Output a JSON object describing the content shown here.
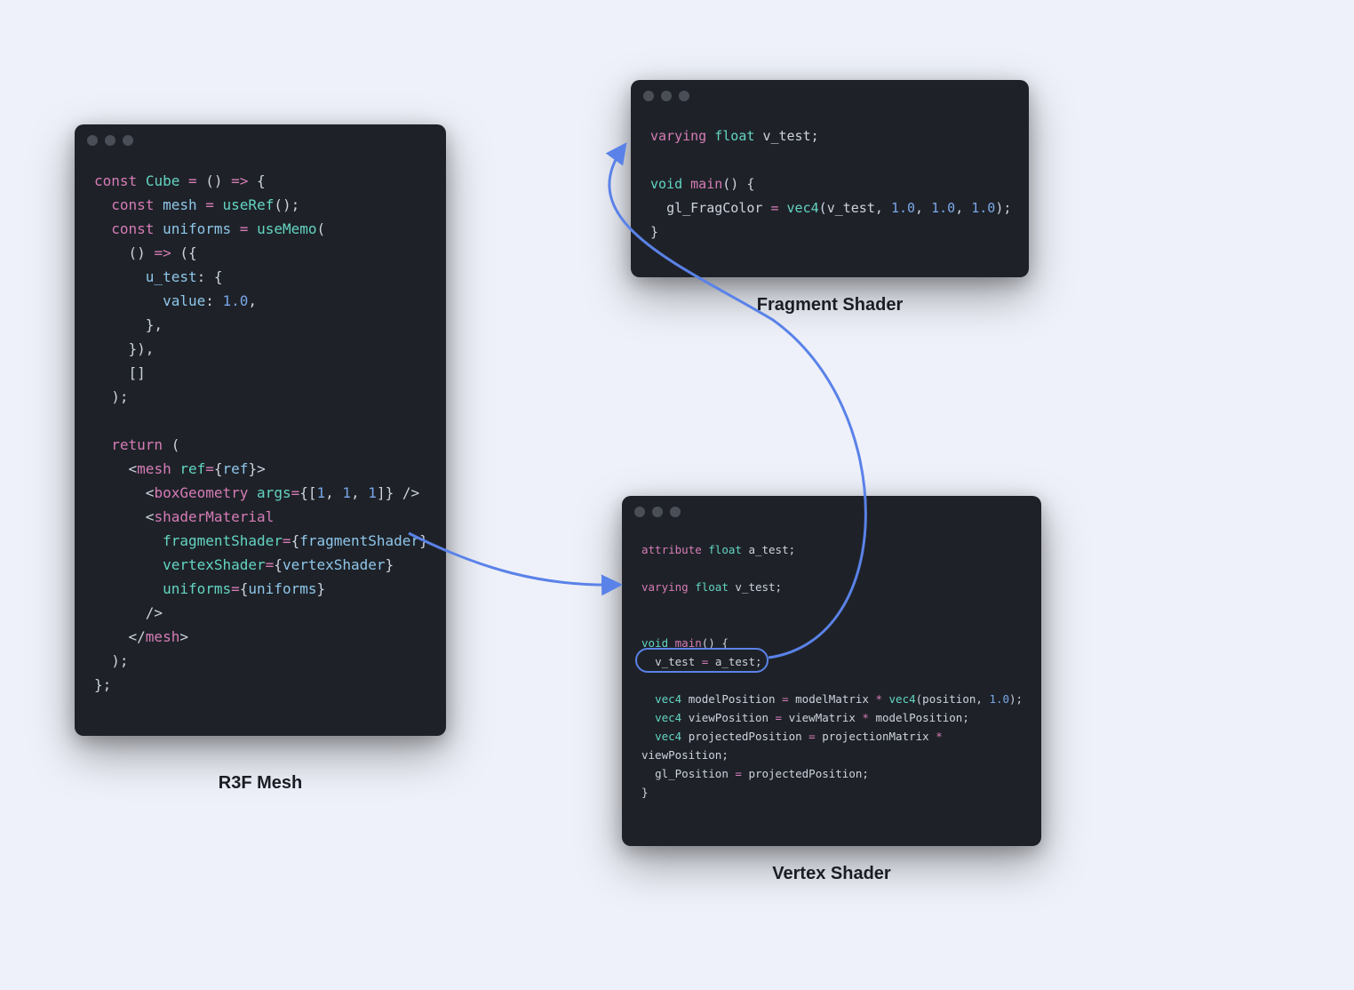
{
  "labels": {
    "r3f": "R3F Mesh",
    "fragment": "Fragment Shader",
    "vertex": "Vertex Shader"
  },
  "windows": {
    "r3f": {
      "fontSize": "16px",
      "lineHeight": "27px",
      "tokens": [
        [
          [
            "tk-kw",
            "const"
          ],
          [
            "tk-punc",
            " "
          ],
          [
            "tk-type",
            "Cube"
          ],
          [
            "tk-punc",
            " "
          ],
          [
            "tk-op",
            "="
          ],
          [
            "tk-punc",
            " () "
          ],
          [
            "tk-op",
            "=>"
          ],
          [
            "tk-punc",
            " {"
          ]
        ],
        [
          [
            "tk-punc",
            "  "
          ],
          [
            "tk-kw",
            "const"
          ],
          [
            "tk-punc",
            " "
          ],
          [
            "tk-prop",
            "mesh"
          ],
          [
            "tk-punc",
            " "
          ],
          [
            "tk-op",
            "="
          ],
          [
            "tk-punc",
            " "
          ],
          [
            "tk-type",
            "useRef"
          ],
          [
            "tk-punc",
            "();"
          ]
        ],
        [
          [
            "tk-punc",
            "  "
          ],
          [
            "tk-kw",
            "const"
          ],
          [
            "tk-punc",
            " "
          ],
          [
            "tk-prop",
            "uniforms"
          ],
          [
            "tk-punc",
            " "
          ],
          [
            "tk-op",
            "="
          ],
          [
            "tk-punc",
            " "
          ],
          [
            "tk-type",
            "useMemo"
          ],
          [
            "tk-punc",
            "("
          ]
        ],
        [
          [
            "tk-punc",
            "    () "
          ],
          [
            "tk-op",
            "=>"
          ],
          [
            "tk-punc",
            " ({"
          ]
        ],
        [
          [
            "tk-punc",
            "      "
          ],
          [
            "tk-prop",
            "u_test"
          ],
          [
            "tk-punc",
            ": {"
          ]
        ],
        [
          [
            "tk-punc",
            "        "
          ],
          [
            "tk-prop",
            "value"
          ],
          [
            "tk-punc",
            ": "
          ],
          [
            "tk-num",
            "1.0"
          ],
          [
            "tk-punc",
            ","
          ]
        ],
        [
          [
            "tk-punc",
            "      },"
          ]
        ],
        [
          [
            "tk-punc",
            "    }),"
          ]
        ],
        [
          [
            "tk-punc",
            "    []"
          ]
        ],
        [
          [
            "tk-punc",
            "  );"
          ]
        ],
        [
          [
            "tk-punc",
            ""
          ]
        ],
        [
          [
            "tk-punc",
            "  "
          ],
          [
            "tk-kw",
            "return"
          ],
          [
            "tk-punc",
            " ("
          ]
        ],
        [
          [
            "tk-punc",
            "    <"
          ],
          [
            "tk-tag",
            "mesh"
          ],
          [
            "tk-punc",
            " "
          ],
          [
            "tk-attr",
            "ref"
          ],
          [
            "tk-op",
            "="
          ],
          [
            "tk-punc",
            "{"
          ],
          [
            "tk-prop",
            "ref"
          ],
          [
            "tk-punc",
            "}>"
          ]
        ],
        [
          [
            "tk-punc",
            "      <"
          ],
          [
            "tk-tag",
            "boxGeometry"
          ],
          [
            "tk-punc",
            " "
          ],
          [
            "tk-attr",
            "args"
          ],
          [
            "tk-op",
            "="
          ],
          [
            "tk-punc",
            "{["
          ],
          [
            "tk-num",
            "1"
          ],
          [
            "tk-punc",
            ", "
          ],
          [
            "tk-num",
            "1"
          ],
          [
            "tk-punc",
            ", "
          ],
          [
            "tk-num",
            "1"
          ],
          [
            "tk-punc",
            "]} />"
          ]
        ],
        [
          [
            "tk-punc",
            "      <"
          ],
          [
            "tk-tag",
            "shaderMaterial"
          ]
        ],
        [
          [
            "tk-punc",
            "        "
          ],
          [
            "tk-attr",
            "fragmentShader"
          ],
          [
            "tk-op",
            "="
          ],
          [
            "tk-punc",
            "{"
          ],
          [
            "tk-prop",
            "fragmentShader"
          ],
          [
            "tk-punc",
            "}"
          ]
        ],
        [
          [
            "tk-punc",
            "        "
          ],
          [
            "tk-attr",
            "vertexShader"
          ],
          [
            "tk-op",
            "="
          ],
          [
            "tk-punc",
            "{"
          ],
          [
            "tk-prop",
            "vertexShader"
          ],
          [
            "tk-punc",
            "}"
          ]
        ],
        [
          [
            "tk-punc",
            "        "
          ],
          [
            "tk-attr",
            "uniforms"
          ],
          [
            "tk-op",
            "="
          ],
          [
            "tk-punc",
            "{"
          ],
          [
            "tk-prop",
            "uniforms"
          ],
          [
            "tk-punc",
            "}"
          ]
        ],
        [
          [
            "tk-punc",
            "      />"
          ]
        ],
        [
          [
            "tk-punc",
            "    </"
          ],
          [
            "tk-tag",
            "mesh"
          ],
          [
            "tk-punc",
            ">"
          ]
        ],
        [
          [
            "tk-punc",
            "  );"
          ]
        ],
        [
          [
            "tk-punc",
            "};"
          ]
        ]
      ]
    },
    "fragment": {
      "fontSize": "15px",
      "lineHeight": "27px",
      "tokens": [
        [
          [
            "tk-kw",
            "varying"
          ],
          [
            "tk-punc",
            " "
          ],
          [
            "tk-type",
            "float"
          ],
          [
            "tk-punc",
            " "
          ],
          [
            "tk-ident",
            "v_test"
          ],
          [
            "tk-punc",
            ";"
          ]
        ],
        [
          [
            "tk-punc",
            ""
          ]
        ],
        [
          [
            "tk-type",
            "void"
          ],
          [
            "tk-punc",
            " "
          ],
          [
            "tk-fn",
            "main"
          ],
          [
            "tk-punc",
            "() {"
          ]
        ],
        [
          [
            "tk-punc",
            "  "
          ],
          [
            "tk-ident",
            "gl_FragColor"
          ],
          [
            "tk-punc",
            " "
          ],
          [
            "tk-op",
            "="
          ],
          [
            "tk-punc",
            " "
          ],
          [
            "tk-type",
            "vec4"
          ],
          [
            "tk-punc",
            "("
          ],
          [
            "tk-ident",
            "v_test"
          ],
          [
            "tk-punc",
            ", "
          ],
          [
            "tk-num",
            "1.0"
          ],
          [
            "tk-punc",
            ", "
          ],
          [
            "tk-num",
            "1.0"
          ],
          [
            "tk-punc",
            ", "
          ],
          [
            "tk-num",
            "1.0"
          ],
          [
            "tk-punc",
            ");"
          ]
        ],
        [
          [
            "tk-punc",
            "}"
          ]
        ]
      ]
    },
    "vertex": {
      "fontSize": "12.5px",
      "lineHeight": "21px",
      "tokens": [
        [
          [
            "tk-kw",
            "attribute"
          ],
          [
            "tk-punc",
            " "
          ],
          [
            "tk-type",
            "float"
          ],
          [
            "tk-punc",
            " "
          ],
          [
            "tk-ident",
            "a_test"
          ],
          [
            "tk-punc",
            ";"
          ]
        ],
        [
          [
            "tk-punc",
            ""
          ]
        ],
        [
          [
            "tk-kw",
            "varying"
          ],
          [
            "tk-punc",
            " "
          ],
          [
            "tk-type",
            "float"
          ],
          [
            "tk-punc",
            " "
          ],
          [
            "tk-ident",
            "v_test"
          ],
          [
            "tk-punc",
            ";"
          ]
        ],
        [
          [
            "tk-punc",
            ""
          ]
        ],
        [
          [
            "tk-punc",
            ""
          ]
        ],
        [
          [
            "tk-type",
            "void"
          ],
          [
            "tk-punc",
            " "
          ],
          [
            "tk-fn",
            "main"
          ],
          [
            "tk-punc",
            "() {"
          ]
        ],
        [
          [
            "tk-punc",
            "  "
          ],
          [
            "tk-ident",
            "v_test"
          ],
          [
            "tk-punc",
            " "
          ],
          [
            "tk-op",
            "="
          ],
          [
            "tk-punc",
            " "
          ],
          [
            "tk-ident",
            "a_test"
          ],
          [
            "tk-punc",
            ";"
          ]
        ],
        [
          [
            "tk-punc",
            ""
          ]
        ],
        [
          [
            "tk-punc",
            "  "
          ],
          [
            "tk-type",
            "vec4"
          ],
          [
            "tk-punc",
            " "
          ],
          [
            "tk-ident",
            "modelPosition"
          ],
          [
            "tk-punc",
            " "
          ],
          [
            "tk-op",
            "="
          ],
          [
            "tk-punc",
            " "
          ],
          [
            "tk-ident",
            "modelMatrix"
          ],
          [
            "tk-punc",
            " "
          ],
          [
            "tk-op",
            "*"
          ],
          [
            "tk-punc",
            " "
          ],
          [
            "tk-type",
            "vec4"
          ],
          [
            "tk-punc",
            "("
          ],
          [
            "tk-ident",
            "position"
          ],
          [
            "tk-punc",
            ", "
          ],
          [
            "tk-num",
            "1.0"
          ],
          [
            "tk-punc",
            ");"
          ]
        ],
        [
          [
            "tk-punc",
            "  "
          ],
          [
            "tk-type",
            "vec4"
          ],
          [
            "tk-punc",
            " "
          ],
          [
            "tk-ident",
            "viewPosition"
          ],
          [
            "tk-punc",
            " "
          ],
          [
            "tk-op",
            "="
          ],
          [
            "tk-punc",
            " "
          ],
          [
            "tk-ident",
            "viewMatrix"
          ],
          [
            "tk-punc",
            " "
          ],
          [
            "tk-op",
            "*"
          ],
          [
            "tk-punc",
            " "
          ],
          [
            "tk-ident",
            "modelPosition"
          ],
          [
            "tk-punc",
            ";"
          ]
        ],
        [
          [
            "tk-punc",
            "  "
          ],
          [
            "tk-type",
            "vec4"
          ],
          [
            "tk-punc",
            " "
          ],
          [
            "tk-ident",
            "projectedPosition"
          ],
          [
            "tk-punc",
            " "
          ],
          [
            "tk-op",
            "="
          ],
          [
            "tk-punc",
            " "
          ],
          [
            "tk-ident",
            "projectionMatrix"
          ],
          [
            "tk-punc",
            " "
          ],
          [
            "tk-op",
            "*"
          ],
          [
            "tk-punc",
            " "
          ]
        ],
        [
          [
            "tk-ident",
            "viewPosition"
          ],
          [
            "tk-punc",
            ";"
          ]
        ],
        [
          [
            "tk-punc",
            "  "
          ],
          [
            "tk-ident",
            "gl_Position"
          ],
          [
            "tk-punc",
            " "
          ],
          [
            "tk-op",
            "="
          ],
          [
            "tk-punc",
            " "
          ],
          [
            "tk-ident",
            "projectedPosition"
          ],
          [
            "tk-punc",
            ";"
          ]
        ],
        [
          [
            "tk-punc",
            "}"
          ]
        ]
      ]
    }
  }
}
